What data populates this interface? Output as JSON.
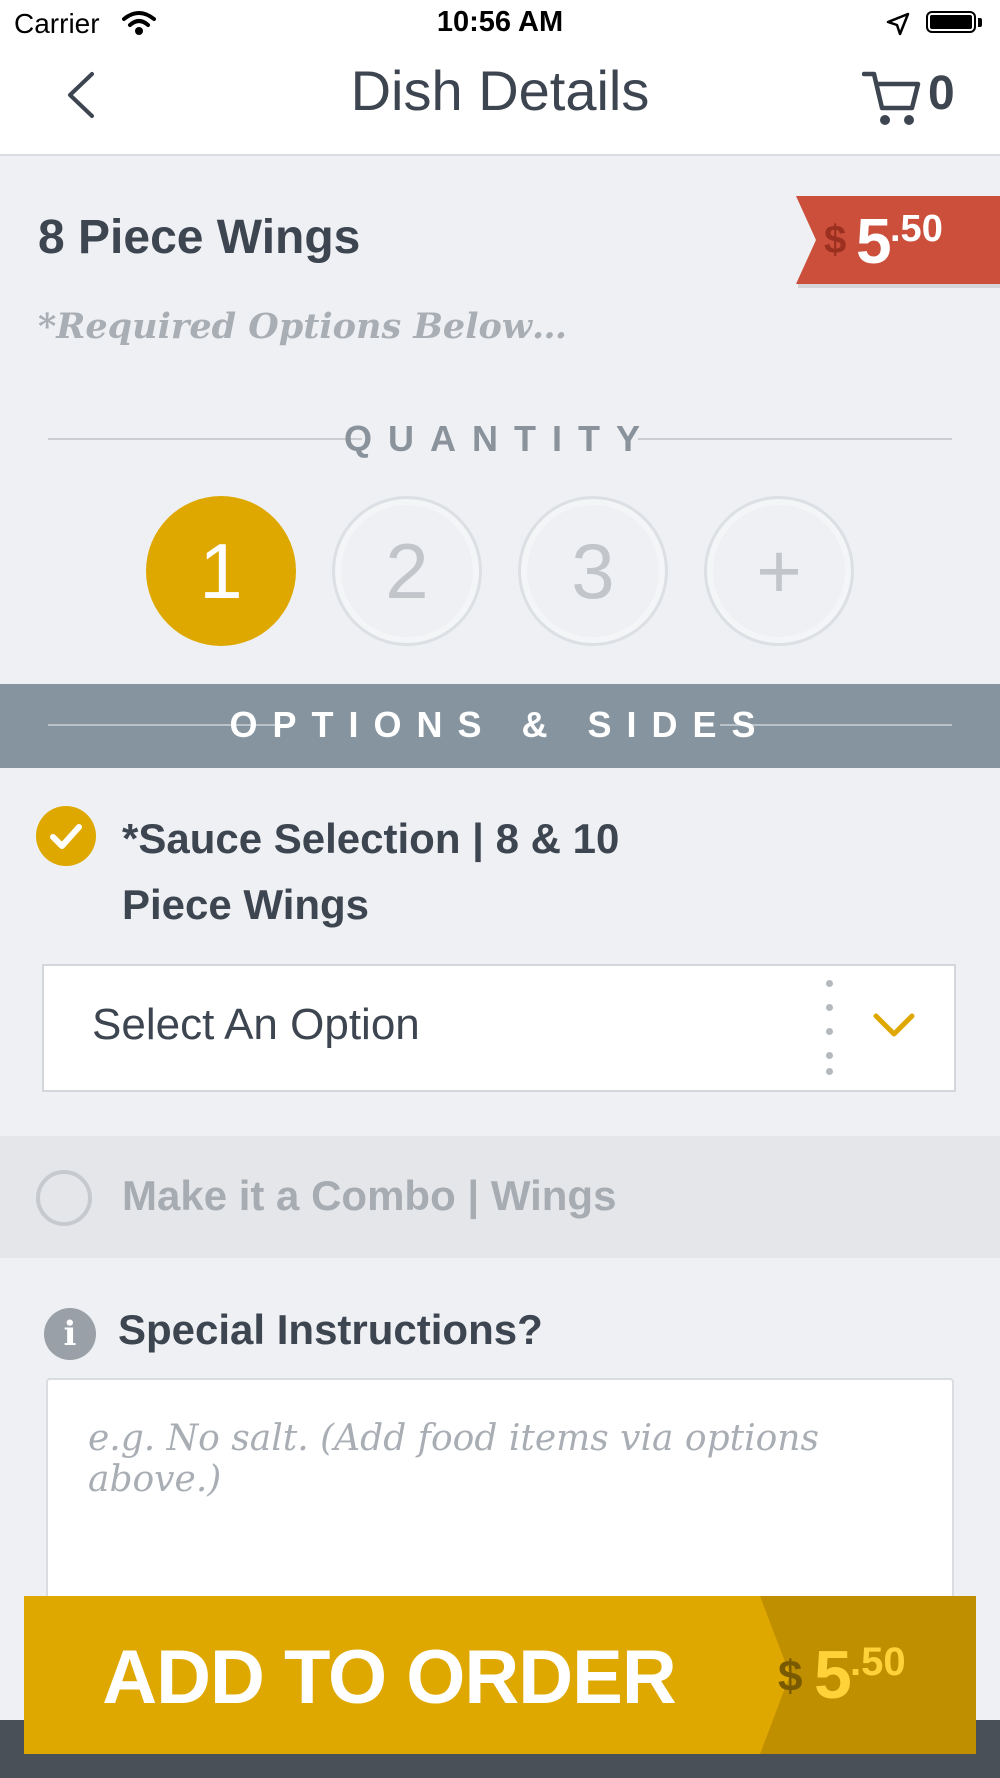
{
  "status_bar": {
    "carrier": "Carrier",
    "time": "10:56 AM"
  },
  "nav": {
    "title": "Dish Details",
    "cart_count": "0"
  },
  "dish": {
    "name": "8 Piece Wings",
    "required_note": "*Required Options Below…",
    "price_dollar_sign": "$",
    "price_whole": "5",
    "price_cents": ".50"
  },
  "quantity": {
    "label": "QUANTITY",
    "options": [
      "1",
      "2",
      "3",
      "+"
    ],
    "selected": "1"
  },
  "options_section": {
    "label": "OPTIONS & SIDES"
  },
  "sauce_option": {
    "title": "*Sauce Selection | 8 & 10 Piece Wings",
    "checked": true,
    "select_placeholder": "Select An Option"
  },
  "combo_option": {
    "title": "Make it a Combo | Wings",
    "checked": false
  },
  "special_instructions": {
    "label": "Special Instructions?",
    "placeholder": "e.g. No salt. (Add food items via options above.)"
  },
  "add_button": {
    "label": "ADD TO ORDER",
    "price_dollar_sign": "$",
    "price_whole": "5",
    "price_cents": ".50"
  },
  "colors": {
    "accent": "#dfa800",
    "price_tag": "#cb4f3a",
    "band": "#86949f",
    "text": "#3d4550"
  }
}
